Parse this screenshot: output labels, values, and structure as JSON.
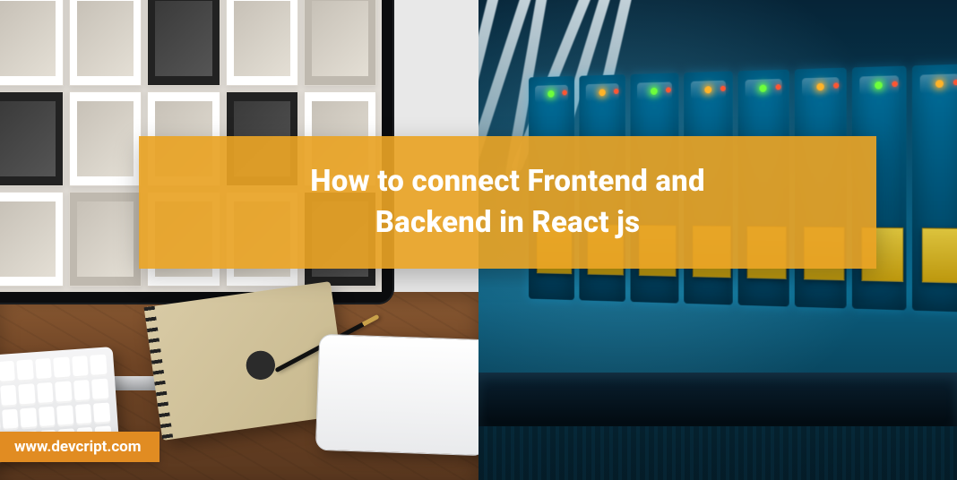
{
  "title_line1": "How to connect Frontend and",
  "title_line2": "Backend in React js",
  "site_url": "www.devcript.com"
}
